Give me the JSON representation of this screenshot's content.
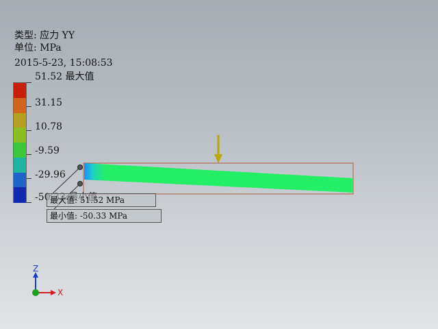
{
  "header": {
    "type_line": "类型: 应力 YY",
    "unit_line": "单位: MPa",
    "timestamp": "2015-5-23, 15:08:53"
  },
  "legend": {
    "levels": [
      "51.52 最大值",
      "31.15",
      "10.78",
      "-9.59",
      "-29.96",
      "-50.33 最小值"
    ],
    "colors": [
      "#c81e0a",
      "#d2641e",
      "#b4a01e",
      "#8cbe1e",
      "#3cc83c",
      "#1eb4a0",
      "#1e64c8",
      "#1428b4"
    ]
  },
  "callouts": {
    "max": "最大值: 51.52 MPa",
    "min": "最小值: -50.33 MPa"
  },
  "model": {
    "beam_color": "#22ee66",
    "outline_color": "#b06040",
    "load_arrow_color": "#b8a800"
  },
  "triad": {
    "z_label": "Z",
    "x_label": "X",
    "z_color": "#1a3ccc",
    "x_color": "#d02020"
  }
}
